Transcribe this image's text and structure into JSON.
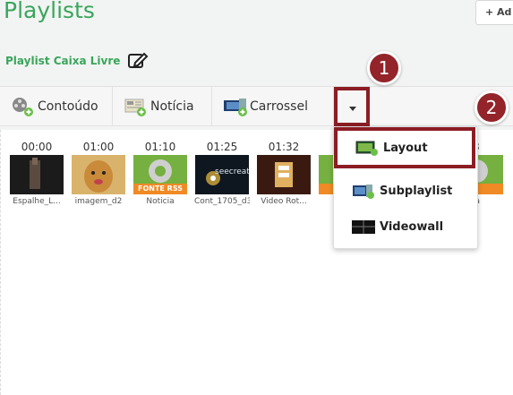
{
  "header": {
    "title": "Playlists",
    "add_label": "+ Ad"
  },
  "playlist": {
    "name": "Playlist Caixa Livre"
  },
  "toolbar": {
    "content_label": "Contoúdo",
    "news_label": "Notícia",
    "carousel_label": "Carrossel"
  },
  "dropdown": {
    "items": [
      {
        "label": "Layout"
      },
      {
        "label": "Subplaylist"
      },
      {
        "label": "Videowall"
      }
    ]
  },
  "timeline": {
    "items": [
      {
        "time": "00:00",
        "name": "Espalhe_L..."
      },
      {
        "time": "01:00",
        "name": "imagem_d2"
      },
      {
        "time": "01:10",
        "name": "Noticia"
      },
      {
        "time": "01:25",
        "name": "Cont_1705_d3"
      },
      {
        "time": "01:32",
        "name": "Video Rot..."
      },
      {
        "time": "",
        "name": "N..."
      },
      {
        "time": "3",
        "name": "ia"
      }
    ],
    "rss_label": "FONTE RSS",
    "seecreate_label": "seecreate"
  },
  "annotations": {
    "badge1": "1",
    "badge2": "2"
  }
}
